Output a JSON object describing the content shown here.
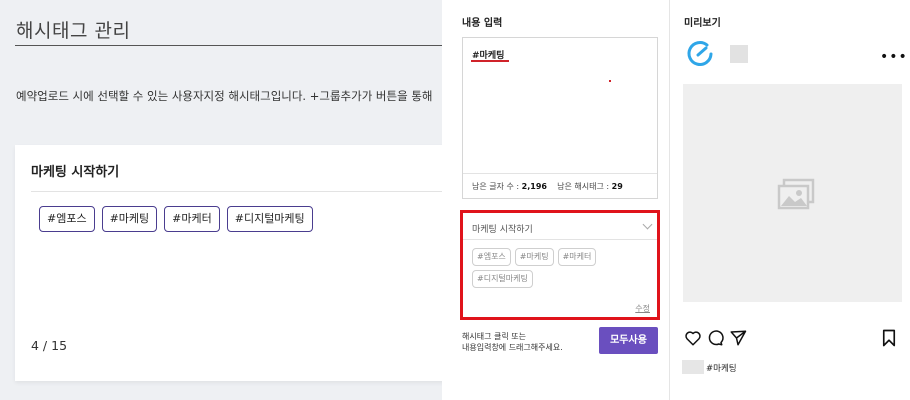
{
  "background_page": {
    "title": "해시태그 관리",
    "description": "예약업로드 시에 선택할 수 있는 사용자지정 해시태그입니다. +그룹추가가 버튼을 통해",
    "group_card": {
      "name": "마케팅 시작하기",
      "tags": [
        "#엠포스",
        "#마케팅",
        "#마케터",
        "#디지털마케팅"
      ],
      "count": "4 / 15"
    }
  },
  "modal": {
    "input_section": {
      "label": "내용 입력",
      "content_text": "#마케팅",
      "remaining_chars_label": "남은 글자 수 : ",
      "remaining_chars_value": "2,196",
      "remaining_tags_label": "남은 해시태그 : ",
      "remaining_tags_value": "29"
    },
    "group_selector": {
      "selected": "마케팅 시작하기",
      "tags": [
        "#엠포스",
        "#마케팅",
        "#마케터",
        "#디지털마케팅"
      ],
      "edit_label": "수정"
    },
    "hint_lines": [
      "해시태그 클릭 또는",
      "내용입력창에 드래그해주세요."
    ],
    "use_all_label": "모두사용",
    "preview": {
      "label": "미리보기",
      "caption": "#마케팅",
      "more_icon": "more-dots-icon"
    }
  },
  "colors": {
    "accent_purple": "#6a4fbf",
    "highlight_red": "#e0131b",
    "tag_border": "#4a3d8f",
    "ring_blue": "#2fa6e8"
  }
}
